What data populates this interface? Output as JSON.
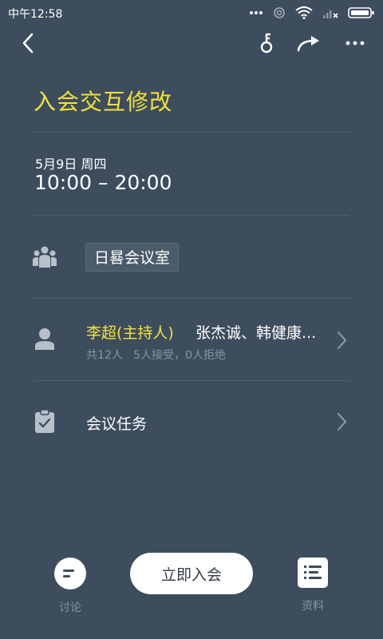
{
  "status_bar": {
    "time": "中午12:58",
    "icons": [
      "more-dots-icon",
      "sync-icon",
      "wifi-icon",
      "signal-icon",
      "battery-icon"
    ]
  },
  "toolbar": {
    "back_icon": "chevron-left-icon",
    "key_icon": "key-icon",
    "share_icon": "share-arrow-icon",
    "more_icon": "more-horizontal-icon"
  },
  "meeting": {
    "title": "入会交互修改",
    "date": "5月9日 周四",
    "time_range": "10:00 – 20:00",
    "room": "日晷会议室"
  },
  "participants": {
    "host": "李超(主持人)",
    "others": "张杰诚、韩健康...",
    "stats": "共12人   5人接受，0人拒绝"
  },
  "tasks": {
    "label": "会议任务"
  },
  "bottom": {
    "discussion_label": "讨论",
    "join_label": "立即入会",
    "materials_label": "资料"
  },
  "colors": {
    "background": "#3d4d5e",
    "accent_yellow": "#f2e23a",
    "muted_text": "#8795a3"
  }
}
